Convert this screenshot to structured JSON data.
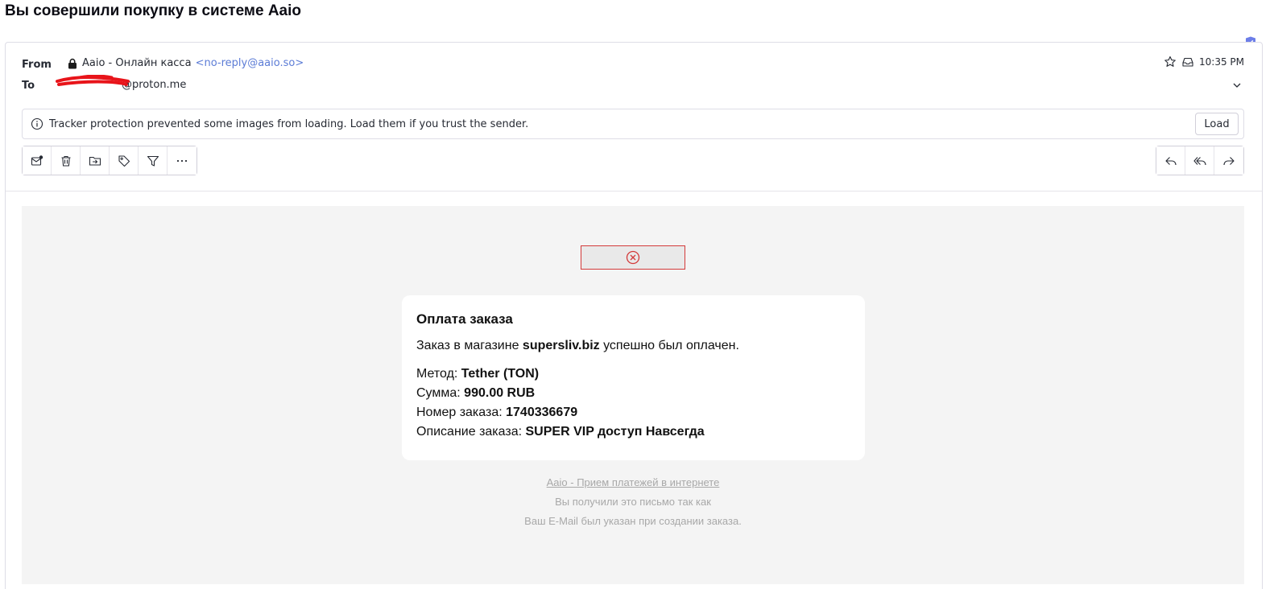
{
  "subject": "Вы совершили покупку в системе Aaio",
  "header": {
    "from_label": "From",
    "to_label": "To",
    "sender_name": "Aaio - Онлайн касса",
    "sender_address": "<no-reply@aaio.so>",
    "recipient": "@proton.me",
    "time": "10:35 PM"
  },
  "banner": {
    "text": "Tracker protection prevented some images from loading. Load them if you trust the sender.",
    "load_label": "Load"
  },
  "icons": {
    "shield": "shield-check-icon",
    "lock": "lock-icon",
    "star": "star-icon",
    "inbox": "inbox-icon",
    "chevron": "chevron-down-icon",
    "info": "info-icon",
    "broken_image": "broken-image-icon"
  },
  "toolbar_left": [
    "mark-unread-icon",
    "trash-icon",
    "move-to-folder-icon",
    "label-icon",
    "filter-icon",
    "more-icon"
  ],
  "toolbar_right": [
    "reply-icon",
    "reply-all-icon",
    "forward-icon"
  ],
  "body": {
    "title": "Оплата заказа",
    "line_prefix": "Заказ в магазине ",
    "shop": "supersliv.biz",
    "line_suffix": " успешно был оплачен.",
    "method_label": "Метод: ",
    "method_value": "Tether (TON)",
    "sum_label": "Сумма: ",
    "sum_value": "990.00 RUB",
    "order_label": "Номер заказа: ",
    "order_value": "1740336679",
    "desc_label": "Описание заказа: ",
    "desc_value": "SUPER VIP доступ Навсегда"
  },
  "footer": {
    "link": "Aaio - Прием платежей в интернете",
    "line1": "Вы получили это письмо так как",
    "line2": "Ваш E-Mail был указан при создании заказа."
  },
  "colors": {
    "link": "#5c7cd6",
    "accent": "#6d4aff",
    "shield": "#6c7ee8",
    "broken_border": "#d33a3a",
    "redaction": "#e8141a"
  }
}
